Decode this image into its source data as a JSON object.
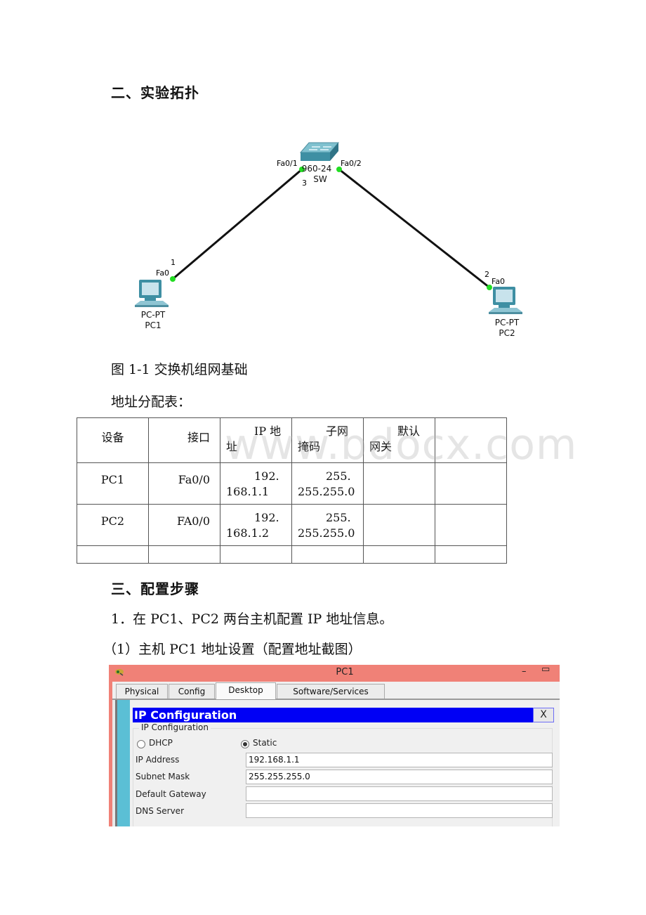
{
  "sections": {
    "topology_heading": "二、实验拓扑",
    "figure_caption": "图 1-1 交换机组网基础",
    "table_caption": "地址分配表：",
    "steps_heading": "三、配置步骤",
    "step1": "1．在 PC1、PC2 两台主机配置 IP 地址信息。",
    "step1_sub1": "（1）主机 PC1 地址设置（配置地址截图）"
  },
  "topology": {
    "switch": {
      "model": "960-24",
      "name": "SW",
      "port_left": "Fa0/1",
      "port_right": "Fa0/2",
      "link_num": "3"
    },
    "pc1": {
      "type": "PC-PT",
      "name": "PC1",
      "port": "Fa0",
      "link_num": "1"
    },
    "pc2": {
      "type": "PC-PT",
      "name": "PC2",
      "port": "Fa0",
      "link_num": "2"
    },
    "link_color": "#111111",
    "port_up_color": "#22dd22"
  },
  "address_table": {
    "headers": [
      "设备",
      "接口",
      "IP 地址",
      "子网掩码",
      "默认网关",
      ""
    ],
    "rows": [
      [
        "PC1",
        "Fa0/0",
        "192.168.1.1",
        "255.255.255.0",
        "",
        ""
      ],
      [
        "PC2",
        "FA0/0",
        "192.168.1.2",
        "255.255.255.0",
        "",
        ""
      ],
      [
        "",
        "",
        "",
        "",
        "",
        ""
      ]
    ]
  },
  "watermark": "www.bdocx.com",
  "pt_window": {
    "title": "PC1",
    "minimize": "–",
    "maximize": "▭",
    "tabs": [
      {
        "label": "Physical",
        "active": false
      },
      {
        "label": "Config",
        "active": false
      },
      {
        "label": "Desktop",
        "active": true
      },
      {
        "label": "Software/Services",
        "active": false
      }
    ],
    "panel_title": "IP Configuration",
    "close_label": "X",
    "group_label": "IP Configuration",
    "mode_options": [
      {
        "label": "DHCP",
        "selected": false
      },
      {
        "label": "Static",
        "selected": true
      }
    ],
    "fields": [
      {
        "label": "IP Address",
        "value": "192.168.1.1"
      },
      {
        "label": "Subnet Mask",
        "value": "255.255.255.0"
      },
      {
        "label": "Default Gateway",
        "value": ""
      },
      {
        "label": "DNS Server",
        "value": ""
      }
    ],
    "colors": {
      "titlebar": "#f08177",
      "header": "#0000f5",
      "sidebar": "#5bbfd5"
    }
  }
}
